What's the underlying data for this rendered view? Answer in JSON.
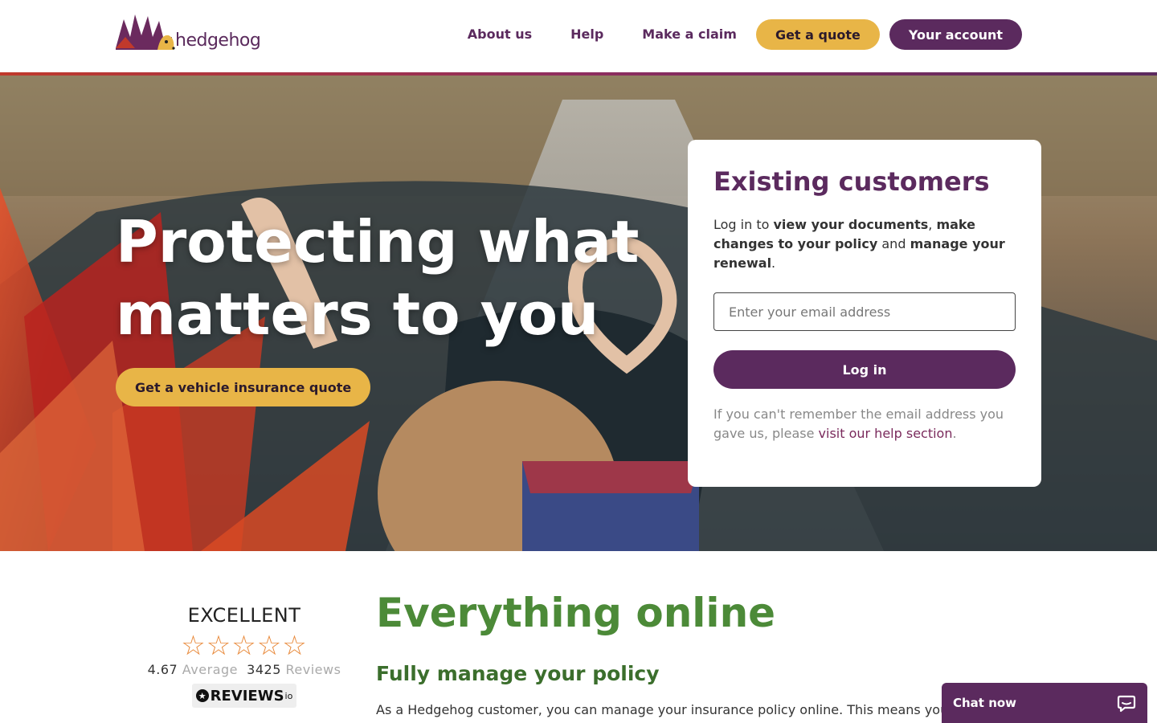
{
  "header": {
    "logo_text": "hedgehog",
    "nav": {
      "about": "About us",
      "help": "Help",
      "claim": "Make a claim",
      "quote": "Get a quote",
      "account": "Your account"
    }
  },
  "hero": {
    "title": "Protecting what matters to you",
    "cta": "Get a vehicle insurance quote"
  },
  "login_card": {
    "title": "Existing customers",
    "intro_prefix": "Log in to ",
    "intro_b1": "view your documents",
    "intro_sep1": ", ",
    "intro_b2": "make changes to your policy",
    "intro_sep2": " and ",
    "intro_b3": "manage your renewal",
    "intro_end": ".",
    "email_placeholder": "Enter your email address",
    "login_button": "Log in",
    "help_prefix": "If you can't remember the email address you gave us, please ",
    "help_link": "visit our help section",
    "help_suffix": "."
  },
  "reviews": {
    "rating_label": "EXCELLENT",
    "stars": "☆☆☆☆☆",
    "average": "4.67",
    "average_label": "Average",
    "count": "3425",
    "count_label": "Reviews",
    "logo_text": "REVIEWS",
    "logo_suffix": "io"
  },
  "online": {
    "title": "Everything online",
    "subtitle": "Fully manage your policy",
    "text": "As a Hedgehog customer, you can manage your insurance policy online. This means you"
  },
  "chat": {
    "label": "Chat now"
  },
  "colors": {
    "brand_purple": "#5b2a5e",
    "accent_yellow": "#e8b547",
    "green": "#4c8a38"
  }
}
